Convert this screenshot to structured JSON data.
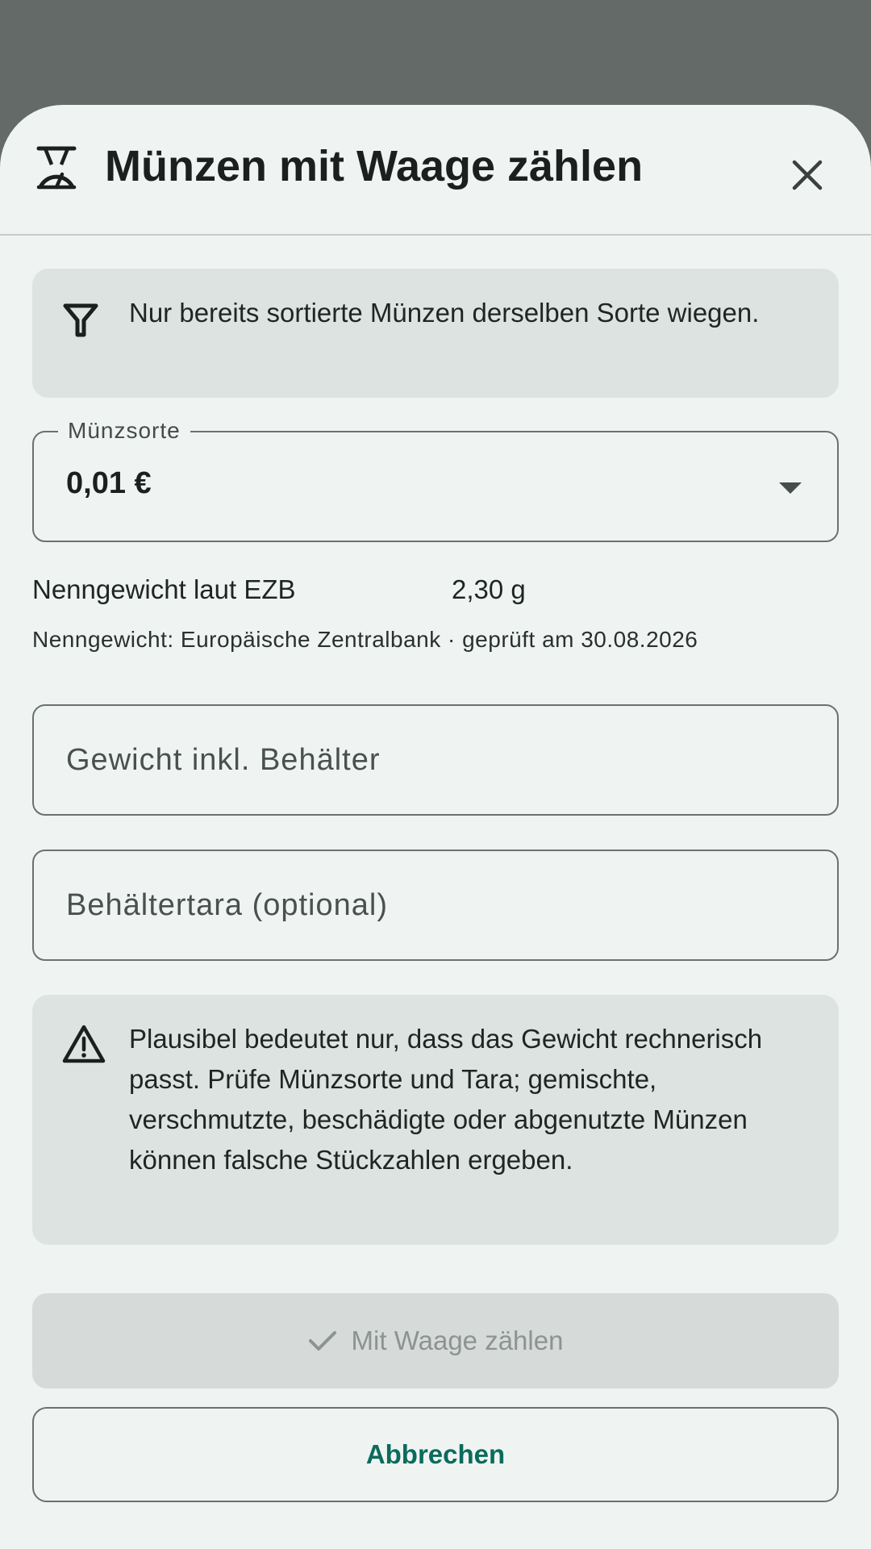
{
  "dialog": {
    "title": "Münzen mit Waage zählen",
    "icons": {
      "header": "scale-icon",
      "close": "close-icon"
    }
  },
  "hint": {
    "icon": "filter-icon",
    "text": "Nur bereits sortierte Münzen derselben Sorte wiegen."
  },
  "coin_type": {
    "label": "Münzsorte",
    "value": "0,01 €",
    "icon": "dropdown-arrow-icon"
  },
  "nominal_weight": {
    "label": "Nenngewicht laut EZB",
    "value": "2,30 g",
    "source": "Nenngewicht: Europäische Zentralbank · geprüft am 30.08.2026"
  },
  "fields": {
    "gross_weight": {
      "placeholder": "Gewicht inkl. Behälter",
      "value": ""
    },
    "tare": {
      "placeholder": "Behältertara (optional)",
      "value": ""
    }
  },
  "warning": {
    "icon": "warning-icon",
    "text": "Plausibel bedeutet nur, dass das Gewicht rechnerisch passt. Prüfe Münzsorte und Tara; gemischte, verschmutzte, beschädigte oder abgenutzte Münzen können falsche Stückzahlen ergeben."
  },
  "actions": {
    "confirm_label": "Mit Waage zählen",
    "confirm_icon": "check-icon",
    "confirm_enabled": false,
    "cancel_label": "Abbrechen"
  },
  "colors": {
    "accent": "#0b6b5c",
    "surface": "#eff4f2",
    "card": "#dde3e1",
    "scrim": "#646a67"
  }
}
